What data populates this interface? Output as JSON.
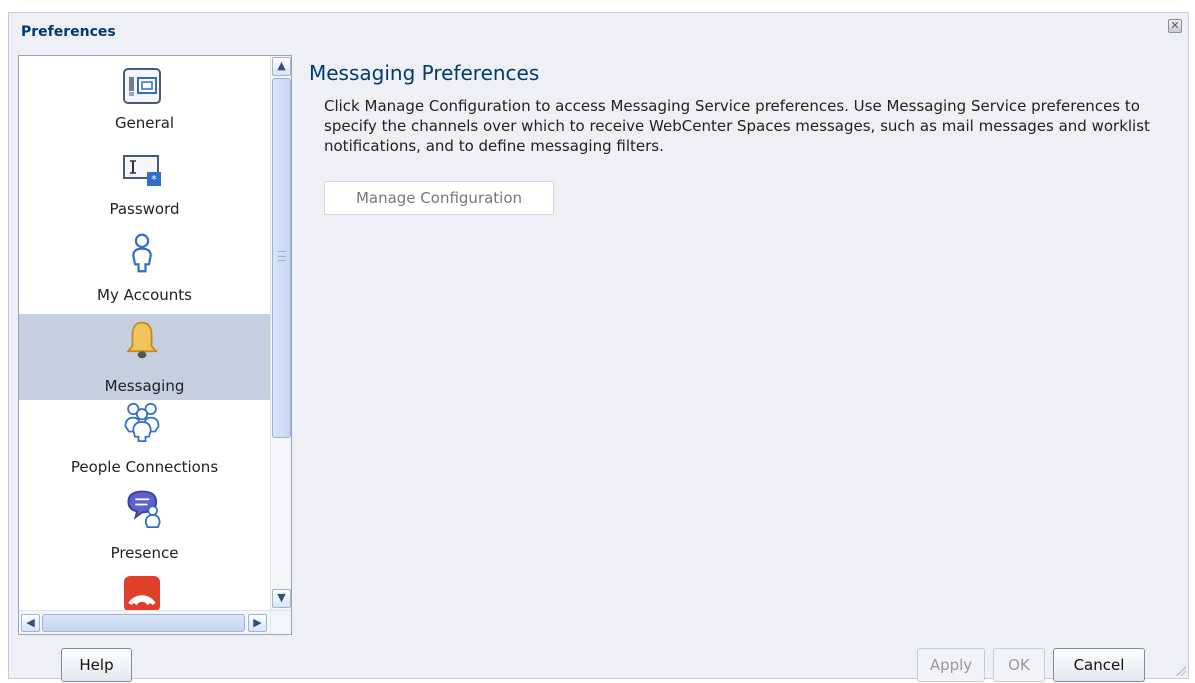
{
  "dialog": {
    "title": "Preferences",
    "close_icon": "close-icon"
  },
  "nav": {
    "items": [
      {
        "label": "General",
        "icon": "general-settings-icon",
        "selected": false
      },
      {
        "label": "Password",
        "icon": "password-icon",
        "selected": false
      },
      {
        "label": "My Accounts",
        "icon": "person-icon",
        "selected": false
      },
      {
        "label": "Messaging",
        "icon": "bell-icon",
        "selected": true
      },
      {
        "label": "People Connections",
        "icon": "people-group-icon",
        "selected": false
      },
      {
        "label": "Presence",
        "icon": "presence-chat-icon",
        "selected": false
      },
      {
        "label": "",
        "icon": "feed-icon",
        "selected": false
      }
    ]
  },
  "content": {
    "title": "Messaging Preferences",
    "description": "Click Manage Configuration to access Messaging Service preferences. Use Messaging Service preferences to specify the channels over which to receive WebCenter Spaces messages, such as mail messages and worklist notifications, and to define messaging filters.",
    "manage_button": "Manage Configuration"
  },
  "footer": {
    "help": "Help",
    "apply": "Apply",
    "ok": "OK",
    "cancel": "Cancel"
  },
  "colors": {
    "title": "#003b6f",
    "selected_bg": "#c5cfe0",
    "dialog_bg": "#eef0f5"
  }
}
